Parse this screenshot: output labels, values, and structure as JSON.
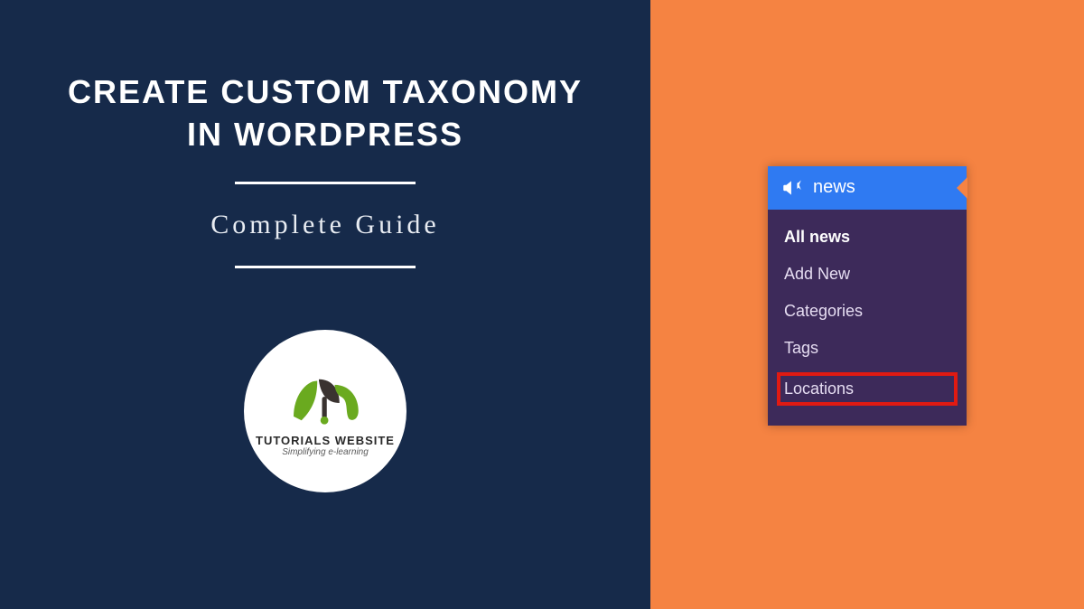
{
  "left": {
    "title_line1": "CREATE CUSTOM TAXONOMY",
    "title_line2": "IN WORDPRESS",
    "subtitle": "Complete Guide"
  },
  "logo": {
    "brand_main": "TUTORIALS WEBSITE",
    "brand_sub": "Simplifying e-learning"
  },
  "wp_menu": {
    "header_label": "news",
    "items": [
      {
        "label": "All news",
        "active": true,
        "highlight": false
      },
      {
        "label": "Add New",
        "active": false,
        "highlight": false
      },
      {
        "label": "Categories",
        "active": false,
        "highlight": false
      },
      {
        "label": "Tags",
        "active": false,
        "highlight": false
      },
      {
        "label": "Locations",
        "active": false,
        "highlight": true
      }
    ]
  },
  "colors": {
    "left_bg": "#162a4a",
    "right_bg": "#f58342",
    "menu_bg": "#3d2a5a",
    "menu_hdr": "#2f7af2",
    "hl": "#e11a12"
  }
}
